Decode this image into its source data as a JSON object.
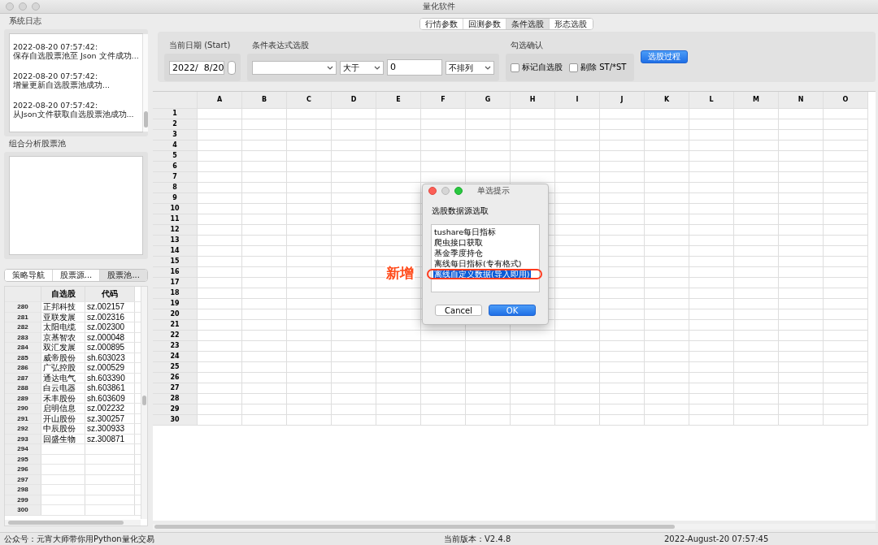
{
  "window": {
    "title": "量化软件"
  },
  "system_log": {
    "title": "系统日志",
    "entries": [
      {
        "time": "2022-08-20 07:57:42:",
        "message": "保存自选股票池至 Json 文件成功..."
      },
      {
        "time": "2022-08-20 07:57:42:",
        "message": "增量更新自选股票池成功..."
      },
      {
        "time": "2022-08-20 07:57:42:",
        "message": "从Json文件获取自选股票池成功..."
      }
    ]
  },
  "portfolio_pool": {
    "title": "组合分析股票池"
  },
  "left_tabs": [
    {
      "label": "策略导航",
      "selected": false
    },
    {
      "label": "股票源...",
      "selected": false
    },
    {
      "label": "股票池...",
      "selected": true
    }
  ],
  "stock_table": {
    "columns": [
      "自选股",
      "代码"
    ],
    "rows": [
      {
        "index": "280",
        "name": "正邦科技",
        "code": "sz.002157"
      },
      {
        "index": "281",
        "name": "亚联发展",
        "code": "sz.002316"
      },
      {
        "index": "282",
        "name": "太阳电缆",
        "code": "sz.002300"
      },
      {
        "index": "283",
        "name": "京基智农",
        "code": "sz.000048"
      },
      {
        "index": "284",
        "name": "双汇发展",
        "code": "sz.000895"
      },
      {
        "index": "285",
        "name": "威帝股份",
        "code": "sh.603023"
      },
      {
        "index": "286",
        "name": "广弘控股",
        "code": "sz.000529"
      },
      {
        "index": "287",
        "name": "通达电气",
        "code": "sh.603390"
      },
      {
        "index": "288",
        "name": "白云电器",
        "code": "sh.603861"
      },
      {
        "index": "289",
        "name": "禾丰股份",
        "code": "sh.603609"
      },
      {
        "index": "290",
        "name": "启明信息",
        "code": "sz.002232"
      },
      {
        "index": "291",
        "name": "开山股份",
        "code": "sz.300257"
      },
      {
        "index": "292",
        "name": "中辰股份",
        "code": "sz.300933"
      },
      {
        "index": "293",
        "name": "回盛生物",
        "code": "sz.300871"
      },
      {
        "index": "294"
      },
      {
        "index": "295"
      },
      {
        "index": "296"
      },
      {
        "index": "297"
      },
      {
        "index": "298"
      },
      {
        "index": "299"
      },
      {
        "index": "300"
      }
    ]
  },
  "top_tabs": [
    {
      "label": "行情参数",
      "selected": false
    },
    {
      "label": "回测参数",
      "selected": false
    },
    {
      "label": "条件选股",
      "selected": true
    },
    {
      "label": "形态选股",
      "selected": false
    }
  ],
  "date_group": {
    "title": "当前日期 (Start)",
    "value": "2022/  8/20"
  },
  "condition_group": {
    "title": "条件表达式选股",
    "operator": "大于",
    "threshold": "0",
    "sort": "不排列"
  },
  "confirm_group": {
    "title": "勾选确认",
    "checkboxes": [
      {
        "label": "标记自选股",
        "checked": false
      },
      {
        "label": "剔除 ST/*ST",
        "checked": false
      }
    ]
  },
  "run_button": "选股过程",
  "grid": {
    "columns": [
      "A",
      "B",
      "C",
      "D",
      "E",
      "F",
      "G",
      "H",
      "I",
      "J",
      "K",
      "L",
      "M",
      "N",
      "O"
    ],
    "rows": [
      "1",
      "2",
      "3",
      "4",
      "5",
      "6",
      "7",
      "8",
      "9",
      "10",
      "11",
      "12",
      "13",
      "14",
      "15",
      "16",
      "17",
      "18",
      "19",
      "20",
      "21",
      "22",
      "23",
      "24",
      "25",
      "26",
      "27",
      "28",
      "29",
      "30"
    ]
  },
  "dialog": {
    "title": "单选提示",
    "prompt": "选股数据源选取",
    "options": [
      {
        "label": "tushare每日指标",
        "selected": false
      },
      {
        "label": "爬虫接口获取",
        "selected": false
      },
      {
        "label": "基金季度持仓",
        "selected": false
      },
      {
        "label": "离线每日指标(专有格式)",
        "selected": false
      },
      {
        "label": "离线自定义数据(导入即用)",
        "selected": true
      }
    ],
    "buttons": [
      {
        "label": "Cancel",
        "kind": "secondary"
      },
      {
        "label": "OK",
        "kind": "primary"
      }
    ]
  },
  "annotation": {
    "text": "新增"
  },
  "status_bar": {
    "account": "公众号：元宵大师带你用Python量化交易",
    "version": "当前版本：V2.4.8",
    "time": "2022-August-20 07:57:45"
  }
}
